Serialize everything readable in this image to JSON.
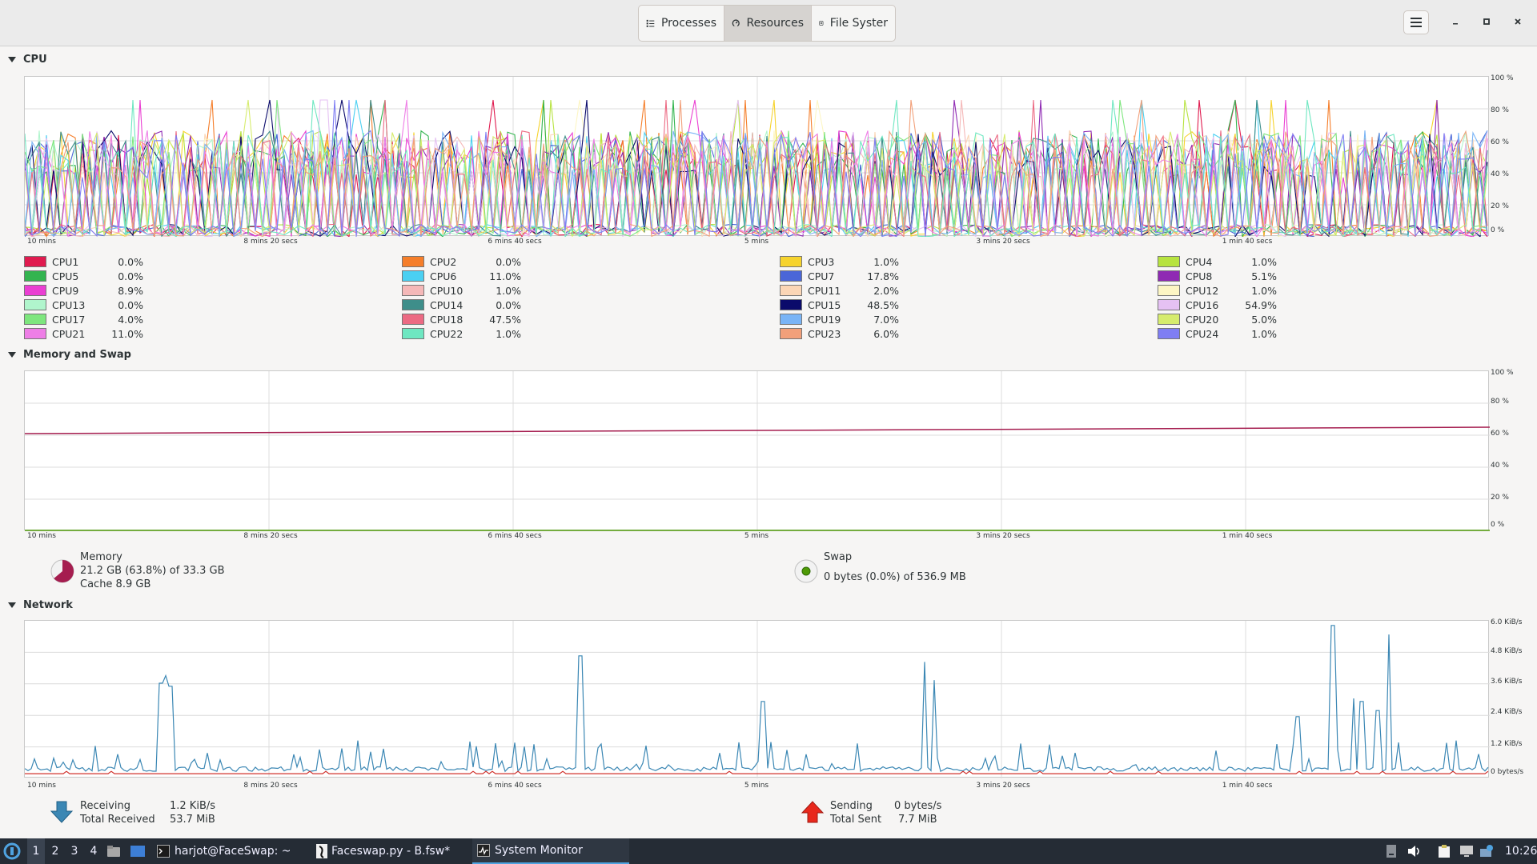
{
  "header": {
    "tabs": [
      {
        "label": "Processes",
        "icon": "list-icon"
      },
      {
        "label": "Resources",
        "icon": "gauge-icon"
      },
      {
        "label": "File Syster",
        "icon": "disk-icon"
      }
    ],
    "active_tab": "Resources"
  },
  "x_labels": [
    "10 mins",
    "8 mins 20 secs",
    "6 mins 40 secs",
    "5 mins",
    "3 mins 20 secs",
    "1 min 40 secs"
  ],
  "cpu": {
    "title": "CPU",
    "y_labels": [
      "100 %",
      "80 %",
      "60 %",
      "40 %",
      "20 %",
      "0 %"
    ],
    "cores": [
      {
        "name": "CPU1",
        "value": "0.0%",
        "color": "#e01b4f"
      },
      {
        "name": "CPU2",
        "value": "0.0%",
        "color": "#f57e2a"
      },
      {
        "name": "CPU3",
        "value": "1.0%",
        "color": "#f6d32d"
      },
      {
        "name": "CPU4",
        "value": "1.0%",
        "color": "#b7e33f"
      },
      {
        "name": "CPU5",
        "value": "0.0%",
        "color": "#33b44f"
      },
      {
        "name": "CPU6",
        "value": "11.0%",
        "color": "#4ad0f2"
      },
      {
        "name": "CPU7",
        "value": "17.8%",
        "color": "#4a66d8"
      },
      {
        "name": "CPU8",
        "value": "5.1%",
        "color": "#8f2ab3"
      },
      {
        "name": "CPU9",
        "value": "8.9%",
        "color": "#ea3fd2"
      },
      {
        "name": "CPU10",
        "value": "1.0%",
        "color": "#f5b8b8"
      },
      {
        "name": "CPU11",
        "value": "2.0%",
        "color": "#fbd6b6"
      },
      {
        "name": "CPU12",
        "value": "1.0%",
        "color": "#fdf6c4"
      },
      {
        "name": "CPU13",
        "value": "0.0%",
        "color": "#b0f5cc"
      },
      {
        "name": "CPU14",
        "value": "0.0%",
        "color": "#3e8e8a"
      },
      {
        "name": "CPU15",
        "value": "48.5%",
        "color": "#0b0b6b"
      },
      {
        "name": "CPU16",
        "value": "54.9%",
        "color": "#e5c1f3"
      },
      {
        "name": "CPU17",
        "value": "4.0%",
        "color": "#7ee67e"
      },
      {
        "name": "CPU18",
        "value": "47.5%",
        "color": "#ec6a83"
      },
      {
        "name": "CPU19",
        "value": "7.0%",
        "color": "#79b4f6"
      },
      {
        "name": "CPU20",
        "value": "5.0%",
        "color": "#d6ec6d"
      },
      {
        "name": "CPU21",
        "value": "11.0%",
        "color": "#ee7ee6"
      },
      {
        "name": "CPU22",
        "value": "1.0%",
        "color": "#6ee7c1"
      },
      {
        "name": "CPU23",
        "value": "6.0%",
        "color": "#f2a07a"
      },
      {
        "name": "CPU24",
        "value": "1.0%",
        "color": "#7f7ef3"
      }
    ]
  },
  "memory": {
    "title": "Memory and Swap",
    "y_labels": [
      "100 %",
      "80 %",
      "60 %",
      "40 %",
      "20 %",
      "0 %"
    ],
    "memory_label": "Memory",
    "memory_value": "21.2 GB (63.8%) of 33.3 GB",
    "cache_value": "Cache 8.9 GB",
    "memory_fraction": 0.638,
    "memory_color": "#a51d4f",
    "swap_label": "Swap",
    "swap_value": "0 bytes (0.0%) of 536.9 MB",
    "swap_color": "#4e9a06"
  },
  "network": {
    "title": "Network",
    "y_labels": [
      "6.0 KiB/s",
      "4.8 KiB/s",
      "3.6 KiB/s",
      "2.4 KiB/s",
      "1.2 KiB/s",
      "0 bytes/s"
    ],
    "receiving_label": "Receiving",
    "receiving_value": "1.2 KiB/s",
    "total_received_label": "Total Received",
    "total_received_value": "53.7 MiB",
    "sending_label": "Sending",
    "sending_value": "0 bytes/s",
    "total_sent_label": "Total Sent",
    "total_sent_value": "7.7 MiB",
    "receive_color": "#3b87b4",
    "send_color": "#d0302b"
  },
  "taskbar": {
    "workspaces": [
      "1",
      "2",
      "3",
      "4"
    ],
    "windows": [
      {
        "label": "harjot@FaceSwap: ~"
      },
      {
        "label": "Faceswap.py - B.fsw*"
      },
      {
        "label": "System Monitor"
      }
    ],
    "clock": "10:26"
  }
}
